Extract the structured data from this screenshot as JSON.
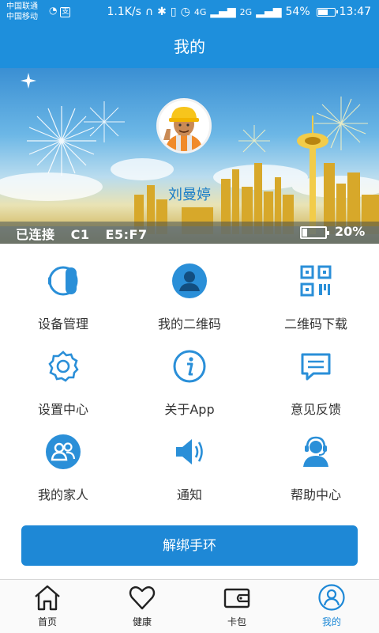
{
  "status_bar": {
    "carrier_1": "中国联通",
    "carrier_2": "中国移动",
    "speed": "1.1K/s",
    "network_4g": "4G",
    "network_2g": "2G",
    "battery": "54%",
    "time": "13:47"
  },
  "header": {
    "title": "我的"
  },
  "profile": {
    "name": "刘曼婷",
    "connection_status": "已连接",
    "device_model": "C1",
    "device_id": "E5:F7",
    "band_battery": "20%",
    "band_battery_level": 0.2
  },
  "menu": [
    {
      "label": "设备管理",
      "icon": "watch-icon"
    },
    {
      "label": "我的二维码",
      "icon": "person-icon"
    },
    {
      "label": "二维码下载",
      "icon": "qrcode-icon"
    },
    {
      "label": "设置中心",
      "icon": "gear-icon"
    },
    {
      "label": "关于App",
      "icon": "info-icon"
    },
    {
      "label": "意见反馈",
      "icon": "message-icon"
    },
    {
      "label": "我的家人",
      "icon": "family-icon"
    },
    {
      "label": "通知",
      "icon": "speaker-icon"
    },
    {
      "label": "帮助中心",
      "icon": "support-icon"
    }
  ],
  "unbind_button": {
    "label": "解绑手环"
  },
  "tabs": [
    {
      "label": "首页",
      "icon": "home-icon",
      "active": false
    },
    {
      "label": "健康",
      "icon": "heart-icon",
      "active": false
    },
    {
      "label": "卡包",
      "icon": "wallet-icon",
      "active": false
    },
    {
      "label": "我的",
      "icon": "profile-icon",
      "active": true
    }
  ],
  "colors": {
    "primary": "#1e8fdc",
    "icon_blue": "#2a8fd8",
    "button": "#1e88d6"
  }
}
